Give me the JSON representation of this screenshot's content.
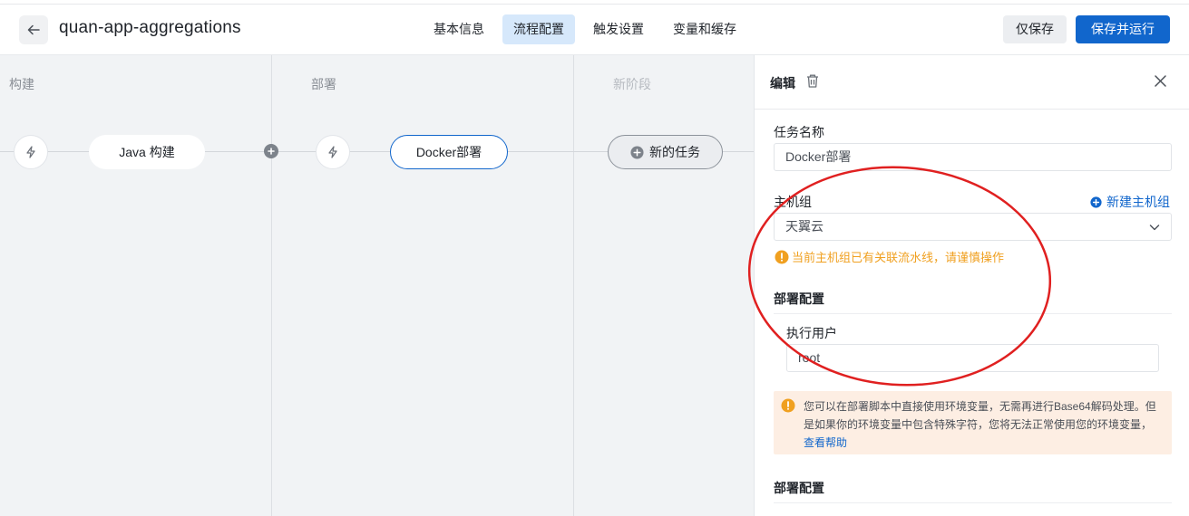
{
  "header": {
    "title": "quan-app-aggregations",
    "tabs": [
      {
        "label": "基本信息"
      },
      {
        "label": "流程配置"
      },
      {
        "label": "触发设置"
      },
      {
        "label": "变量和缓存"
      }
    ],
    "active_tab": "流程配置",
    "save_label": "仅保存",
    "save_run_label": "保存并运行"
  },
  "pipeline": {
    "stages": [
      {
        "title": "构建",
        "task": "Java 构建"
      },
      {
        "title": "部署",
        "task": "Docker部署"
      },
      {
        "title": "新阶段",
        "task": "新的任务"
      }
    ]
  },
  "panel": {
    "title": "编辑",
    "task_name_label": "任务名称",
    "task_name_value": "Docker部署",
    "host_group_label": "主机组",
    "new_host_group_label": "新建主机组",
    "host_group_value": "天翼云",
    "host_group_warning": "当前主机组已有关联流水线，请谨慎操作",
    "deploy_config_label": "部署配置",
    "exec_user_label": "执行用户",
    "exec_user_value": "root",
    "notice_text": "您可以在部署脚本中直接使用环境变量，无需再进行Base64解码处理。但是如果你的环境变量中包含特殊字符，您将无法正常使用您的环境变量，",
    "notice_link": "查看帮助",
    "deploy_config_label_2": "部署配置"
  },
  "colors": {
    "primary": "#1166cc",
    "warning": "#f0a020",
    "annotation": "#e02020"
  }
}
